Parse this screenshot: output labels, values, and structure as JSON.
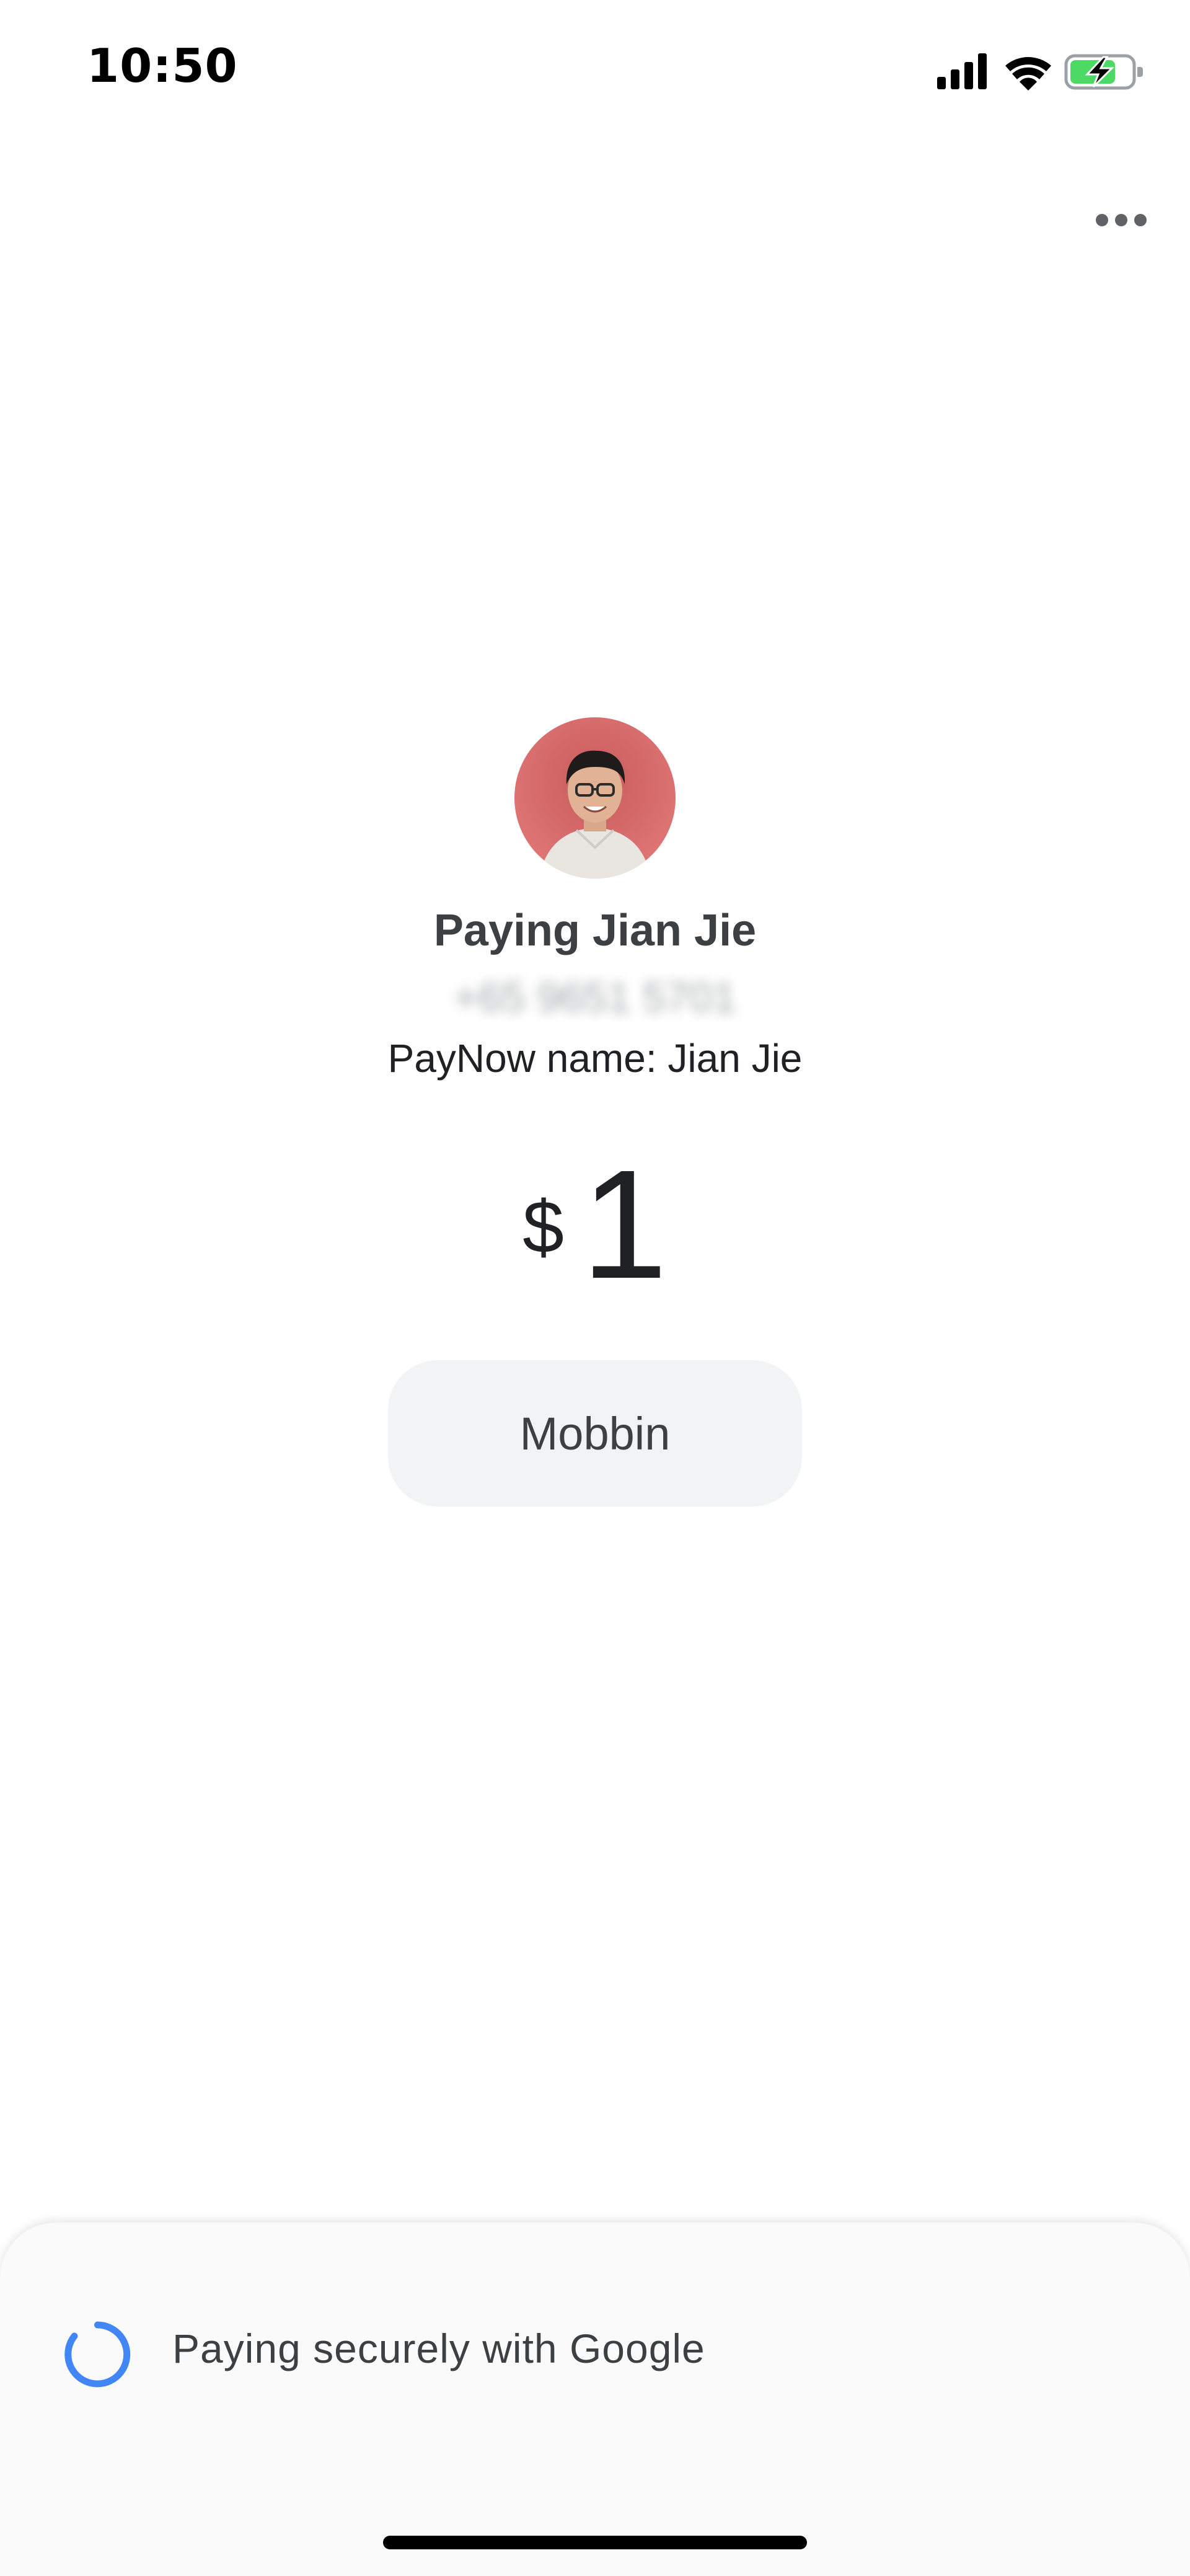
{
  "status_bar": {
    "time": "10:50",
    "icons": [
      "cellular-signal-icon",
      "wifi-icon",
      "battery-charging-icon"
    ]
  },
  "header": {
    "more_icon": "more-horizontal-icon"
  },
  "payee": {
    "avatar": "avatar",
    "title": "Paying Jian Jie",
    "phone": "+65 9651 5701",
    "paynow_name": "PayNow name: Jian Jie"
  },
  "payment": {
    "currency_symbol": "$",
    "amount": "1",
    "note": "Mobbin"
  },
  "bottom_sheet": {
    "status_text": "Paying securely with Google",
    "spinner_icon": "loading-spinner-icon"
  },
  "colors": {
    "accent": "#4285f4",
    "avatar_background": "#d96b6b",
    "chip_background": "#f1f3f4",
    "text_primary": "#202124"
  }
}
